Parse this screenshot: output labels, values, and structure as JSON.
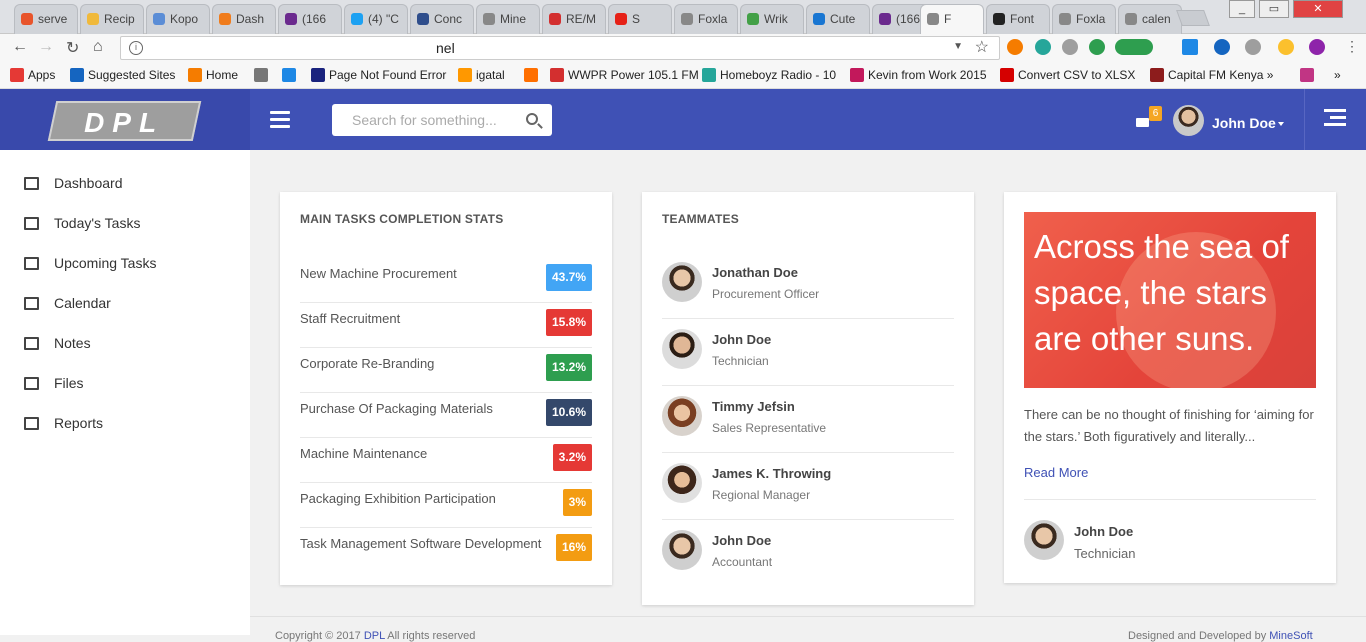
{
  "browser": {
    "tabs": [
      {
        "label": "serve",
        "color": "#e8542b"
      },
      {
        "label": "Recip",
        "color": "#f0b93b"
      },
      {
        "label": "Kopo",
        "color": "#5b8dd6"
      },
      {
        "label": "Dash",
        "color": "#f07c1c"
      },
      {
        "label": "(166",
        "color": "#6b2a8e"
      },
      {
        "label": "(4) \"C",
        "color": "#1da1f2"
      },
      {
        "label": "Conc",
        "color": "#2f4e8c"
      },
      {
        "label": "Mine",
        "color": "#888888"
      },
      {
        "label": "RE/M",
        "color": "#d32f2f"
      },
      {
        "label": "S",
        "color": "#e62117"
      },
      {
        "label": "Foxla",
        "color": "#888888"
      },
      {
        "label": "Wrik",
        "color": "#43a047"
      },
      {
        "label": "Cute",
        "color": "#1976d2"
      },
      {
        "label": "(166",
        "color": "#6b2a8e"
      },
      {
        "label": "F",
        "color": "#888888"
      },
      {
        "label": "Font",
        "color": "#222222"
      },
      {
        "label": "Foxla",
        "color": "#888888"
      },
      {
        "label": "calen",
        "color": "#888888"
      }
    ],
    "address": "nel",
    "bookmarks": [
      {
        "label": "Apps",
        "color": "#e53935"
      },
      {
        "label": "Suggested Sites",
        "color": "#1565c0"
      },
      {
        "label": "Home",
        "color": "#f57c00"
      },
      {
        "label": "",
        "color": "#777777"
      },
      {
        "label": "",
        "color": "#1e88e5"
      },
      {
        "label": "Page Not Found Error",
        "color": "#1a237e"
      },
      {
        "label": "igatal",
        "color": "#ff9800"
      },
      {
        "label": "",
        "color": "#ff6f00"
      },
      {
        "label": "WWPR Power 105.1 FM",
        "color": "#d32f2f"
      },
      {
        "label": "Homeboyz Radio - 10",
        "color": "#26a69a"
      },
      {
        "label": "Kevin from Work 2015",
        "color": "#c2185b"
      },
      {
        "label": "Convert CSV to XLSX",
        "color": "#d50000"
      },
      {
        "label": "Capital FM Kenya »",
        "color": "#8d1c1c"
      },
      {
        "label": "",
        "color": "#c13584"
      }
    ],
    "more_bookmarks": "»"
  },
  "header": {
    "logo": "DPL",
    "search_placeholder": "Search for something...",
    "mail_count": "6",
    "user_name": "John Doe"
  },
  "sidebar": {
    "items": [
      {
        "label": "Dashboard",
        "icon": "home-icon"
      },
      {
        "label": "Today's Tasks",
        "icon": "tasks-icon"
      },
      {
        "label": "Upcoming Tasks",
        "icon": "list-icon"
      },
      {
        "label": "Calendar",
        "icon": "calendar-icon"
      },
      {
        "label": "Notes",
        "icon": "note-icon"
      },
      {
        "label": "Files",
        "icon": "file-icon"
      },
      {
        "label": "Reports",
        "icon": "bar-chart-icon"
      }
    ]
  },
  "stats": {
    "title": "MAIN TASKS COMPLETION STATS",
    "tasks": [
      {
        "name": "New Machine Procurement",
        "value": "43.7%",
        "color": "#42a5f5"
      },
      {
        "name": "Staff Recruitment",
        "value": "15.8%",
        "color": "#e53935"
      },
      {
        "name": "Corporate Re-Branding",
        "value": "13.2%",
        "color": "#2e9e4f"
      },
      {
        "name": "Purchase Of Packaging Materials",
        "value": "10.6%",
        "color": "#34486b"
      },
      {
        "name": "Machine Maintenance",
        "value": "3.2%",
        "color": "#e53935"
      },
      {
        "name": "Packaging Exhibition Participation",
        "value": "3%",
        "color": "#f39c12"
      },
      {
        "name": "Task Management Software Development",
        "value": "16%",
        "color": "#f39c12"
      }
    ]
  },
  "teammates": {
    "title": "TEAMMATES",
    "members": [
      {
        "name": "Jonathan Doe",
        "role": "Procurement Officer"
      },
      {
        "name": "John Doe",
        "role": "Technician"
      },
      {
        "name": "Timmy Jefsin",
        "role": "Sales Representative"
      },
      {
        "name": "James K. Throwing",
        "role": "Regional Manager"
      },
      {
        "name": "John Doe",
        "role": "Accountant"
      }
    ]
  },
  "blog": {
    "quote": "Across the sea of space, the stars are other suns.",
    "excerpt": "There can be no thought of finishing for ‘aiming for the stars.’ Both figuratively and literally...",
    "read_more": "Read More",
    "author_name": "John Doe",
    "author_role": "Technician"
  },
  "footer": {
    "left_prefix": "Copyright © 2017 ",
    "left_link": "DPL",
    "left_suffix": " All rights reserved",
    "right_prefix": "Designed and Developed by ",
    "right_link": "MineSoft"
  }
}
